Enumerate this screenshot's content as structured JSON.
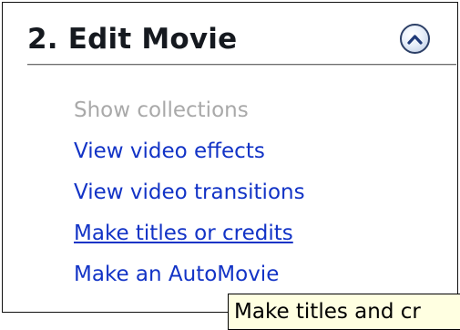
{
  "panel": {
    "title": "2. Edit Movie",
    "collapse_icon": "chevron-up-icon"
  },
  "tasks": [
    {
      "label": "Show collections",
      "state": "disabled"
    },
    {
      "label": "View video effects",
      "state": "link"
    },
    {
      "label": "View video transitions",
      "state": "link"
    },
    {
      "label": "Make titles or credits",
      "state": "hovered"
    },
    {
      "label": "Make an AutoMovie",
      "state": "link"
    }
  ],
  "tooltip": {
    "text": "Make titles and cr"
  },
  "colors": {
    "link": "#1233c6",
    "disabled": "#a9a9a9",
    "title": "#15191f",
    "tooltip_bg": "#ffffe1"
  }
}
